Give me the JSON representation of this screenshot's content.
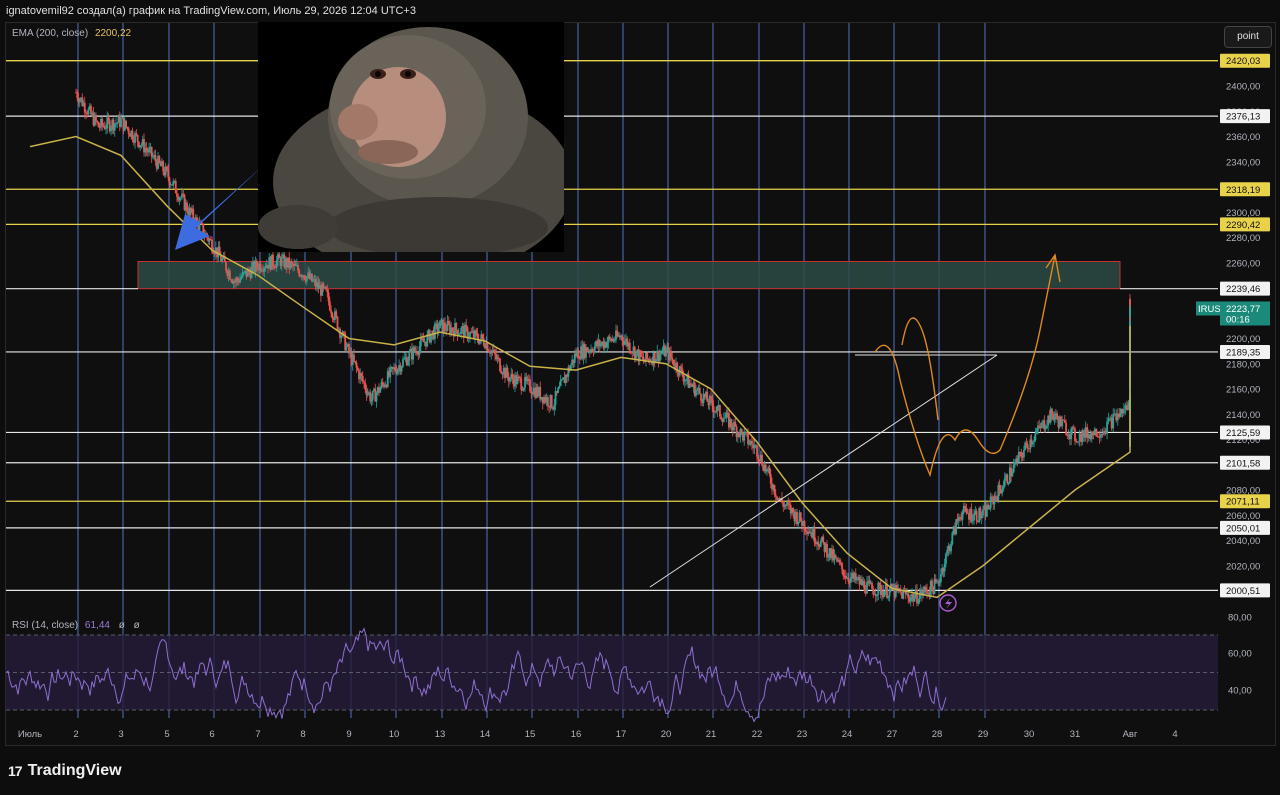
{
  "header": {
    "caption": "ignatovemil92 создал(а) график на TradingView.com, Июль 29, 2026 12:04 UTC+3"
  },
  "indicators": {
    "ema_label": "EMA (200, close)",
    "ema_value": "2200,22",
    "rsi_label": "RSI (14, close)",
    "rsi_value": "61,44",
    "rsi_extra1": "ø",
    "rsi_extra2": "ø"
  },
  "toolbar": {
    "point_label": "point"
  },
  "symbol": {
    "ticker": "IRUS",
    "last_price": "2223,77",
    "countdown": "00:16"
  },
  "footer": {
    "brand": "TradingView"
  },
  "colors": {
    "yellow_level": "#e8d24a",
    "white_level": "#e6e6e6",
    "ema": "#c9b24a",
    "candle_up": "#26a69a",
    "candle_down": "#ef5350",
    "rsi": "#8e6fd1",
    "zone": "#2c4a45",
    "zone_border": "#c83232",
    "vertical_lines": "#5a7fd6",
    "projection": "#e08a1c",
    "arrow": "#3d6be0"
  },
  "chart_data": {
    "type": "candlestick",
    "symbol": "IRUS",
    "ylim": [
      1988,
      2432
    ],
    "y_ticks": [
      "2400,00",
      "2380,00",
      "2360,00",
      "2340,00",
      "2300,00",
      "2280,00",
      "2260,00",
      "2200,00",
      "2180,00",
      "2160,00",
      "2140,00",
      "2120,00",
      "2080,00",
      "2060,00",
      "2040,00",
      "2020,00"
    ],
    "x_ticks": [
      "Июль",
      "2",
      "3",
      "5",
      "6",
      "7",
      "8",
      "9",
      "10",
      "13",
      "14",
      "15",
      "16",
      "17",
      "20",
      "21",
      "22",
      "23",
      "24",
      "27",
      "28",
      "29",
      "30",
      "31",
      "Авг",
      "4"
    ],
    "levels_yellow": [
      "2420,03",
      "2318,19",
      "2290,42",
      "2071,11"
    ],
    "levels_white": [
      "2376,13",
      "2239,46",
      "2189,35",
      "2125,59",
      "2101,58",
      "2050,01",
      "2000,51"
    ],
    "last_price": "2223,77",
    "zone": {
      "from": 2239.46,
      "to": 2261
    },
    "close_path": [
      [
        1,
        2395
      ],
      [
        1.5,
        2368
      ],
      [
        2,
        2372
      ],
      [
        2.5,
        2352
      ],
      [
        3,
        2330
      ],
      [
        3.5,
        2300
      ],
      [
        4,
        2275
      ],
      [
        4.5,
        2245
      ],
      [
        5,
        2258
      ],
      [
        5.5,
        2262
      ],
      [
        6,
        2252
      ],
      [
        6.5,
        2235
      ],
      [
        7,
        2188
      ],
      [
        7.5,
        2152
      ],
      [
        8,
        2175
      ],
      [
        8.5,
        2192
      ],
      [
        9,
        2210
      ],
      [
        9.5,
        2206
      ],
      [
        10,
        2198
      ],
      [
        10.5,
        2170
      ],
      [
        11,
        2162
      ],
      [
        11.5,
        2148
      ],
      [
        12,
        2188
      ],
      [
        12.5,
        2195
      ],
      [
        13,
        2202
      ],
      [
        13.5,
        2182
      ],
      [
        14,
        2190
      ],
      [
        14.5,
        2165
      ],
      [
        15,
        2148
      ],
      [
        15.5,
        2130
      ],
      [
        16,
        2112
      ],
      [
        16.5,
        2072
      ],
      [
        17,
        2055
      ],
      [
        17.5,
        2035
      ],
      [
        18,
        2012
      ],
      [
        18.5,
        2002
      ],
      [
        19,
        2000
      ],
      [
        19.5,
        1995
      ],
      [
        20,
        2005
      ],
      [
        20.5,
        2062
      ],
      [
        21,
        2060
      ],
      [
        21.5,
        2088
      ],
      [
        22,
        2118
      ],
      [
        22.5,
        2140
      ],
      [
        23,
        2122
      ],
      [
        23.5,
        2128
      ],
      [
        24,
        2148
      ],
      [
        24.5,
        2132
      ],
      [
        25,
        2118
      ],
      [
        25.5,
        2122
      ],
      [
        26,
        2168
      ],
      [
        26.5,
        2192
      ],
      [
        27,
        2225
      ],
      [
        27.5,
        2210
      ],
      [
        28,
        2215
      ],
      [
        28.5,
        2205
      ],
      [
        29,
        2228
      ]
    ],
    "ema_path": [
      [
        0,
        2352
      ],
      [
        1,
        2360
      ],
      [
        2,
        2345
      ],
      [
        3,
        2305
      ],
      [
        4,
        2270
      ],
      [
        5,
        2250
      ],
      [
        6,
        2225
      ],
      [
        7,
        2200
      ],
      [
        8,
        2195
      ],
      [
        9,
        2205
      ],
      [
        10,
        2198
      ],
      [
        11,
        2178
      ],
      [
        12,
        2175
      ],
      [
        13,
        2185
      ],
      [
        14,
        2180
      ],
      [
        15,
        2160
      ],
      [
        16,
        2118
      ],
      [
        17,
        2070
      ],
      [
        18,
        2030
      ],
      [
        19,
        2002
      ],
      [
        20,
        1995
      ],
      [
        21,
        2020
      ],
      [
        22,
        2050
      ],
      [
        23,
        2080
      ],
      [
        24,
        2110
      ],
      [
        25,
        2130
      ],
      [
        26,
        2158
      ],
      [
        27,
        2190
      ],
      [
        28,
        2205
      ],
      [
        29,
        2210
      ]
    ],
    "rsi_levels": [
      "80,00",
      "60,00",
      "40,00"
    ],
    "rsi_last": "61,44"
  }
}
